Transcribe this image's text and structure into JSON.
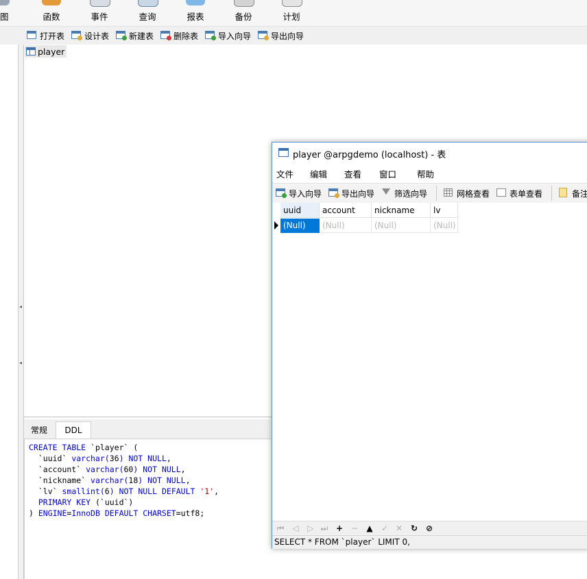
{
  "toolbar": {
    "buttons": [
      {
        "label": "视图",
        "icon": "view-icon"
      },
      {
        "label": "函数",
        "icon": "function-icon"
      },
      {
        "label": "事件",
        "icon": "event-icon"
      },
      {
        "label": "查询",
        "icon": "query-icon"
      },
      {
        "label": "报表",
        "icon": "report-icon"
      },
      {
        "label": "备份",
        "icon": "backup-icon"
      },
      {
        "label": "计划",
        "icon": "schedule-icon"
      }
    ]
  },
  "object_toolbar": {
    "open_table": "打开表",
    "design_table": "设计表",
    "new_table": "新建表",
    "delete_table": "删除表",
    "import_wizard": "导入向导",
    "export_wizard": "导出向导"
  },
  "object_list": {
    "items": [
      {
        "name": "player"
      }
    ]
  },
  "info_panel": {
    "tabs": [
      "常规",
      "DDL"
    ],
    "active_tab": "DDL"
  },
  "ddl": {
    "lines": [
      "CREATE TABLE `player` (",
      "  `uuid` varchar(36) NOT NULL,",
      "  `account` varchar(60) NOT NULL,",
      "  `nickname` varchar(18) NOT NULL,",
      "  `lv` smallint(6) NOT NULL DEFAULT '1',",
      "  PRIMARY KEY (`uuid`)",
      ") ENGINE=InnoDB DEFAULT CHARSET=utf8;"
    ]
  },
  "table_window": {
    "title": "player @arpgdemo (localhost) - 表",
    "menu": [
      "文件",
      "编辑",
      "查看",
      "窗口",
      "帮助"
    ],
    "toolbar": {
      "import_wizard": "导入向导",
      "export_wizard": "导出向导",
      "filter_wizard": "筛选向导",
      "grid_view": "网格查看",
      "form_view": "表单查看",
      "memo": "备注"
    },
    "grid": {
      "columns": [
        "uuid",
        "account",
        "nickname",
        "lv"
      ],
      "rows": [
        [
          "(Null)",
          "(Null)",
          "(Null)",
          "(Null)"
        ]
      ]
    },
    "status": "SELECT * FROM `player` LIMIT 0,"
  },
  "colors": {
    "selection": "#0078d7",
    "window_border": "#5a8fcf",
    "keyword": "#0000cc",
    "null_text": "#b8b8b8"
  }
}
